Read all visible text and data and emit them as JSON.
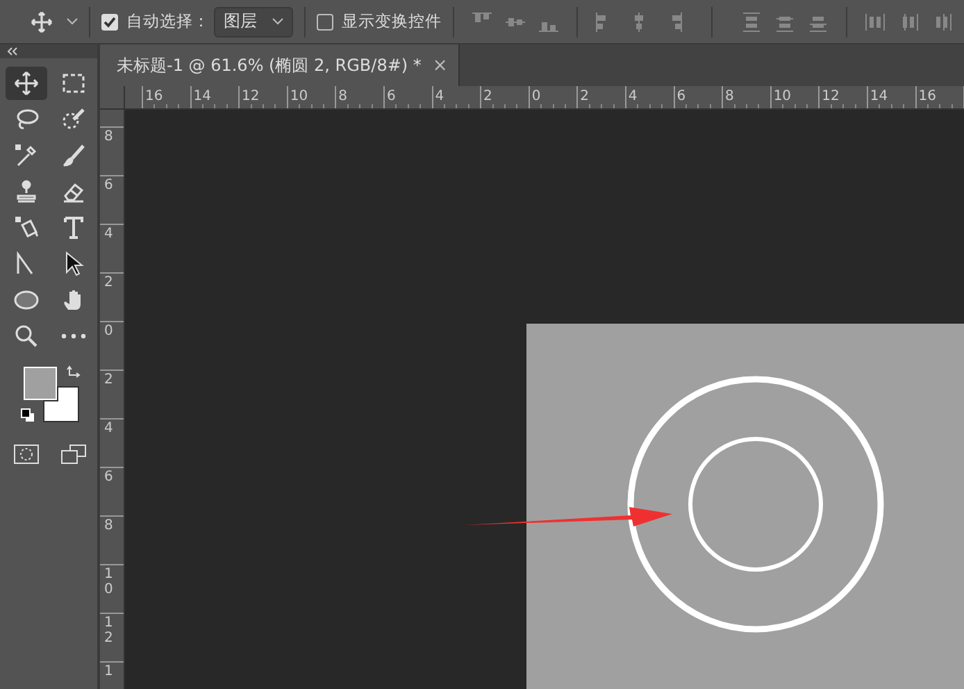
{
  "options_bar": {
    "auto_select": {
      "checked": true,
      "label": "自动选择："
    },
    "layer_dropdown": {
      "value": "图层"
    },
    "show_transform": {
      "checked": false,
      "label": "显示变换控件"
    }
  },
  "toolbox": {
    "tools": [
      {
        "kind": "move",
        "selected": true
      },
      {
        "kind": "marquee",
        "selected": false
      },
      {
        "kind": "lasso",
        "selected": false
      },
      {
        "kind": "quick-select",
        "selected": false
      },
      {
        "kind": "eyedropper",
        "selected": false
      },
      {
        "kind": "brush",
        "selected": false
      },
      {
        "kind": "stamp",
        "selected": false
      },
      {
        "kind": "eraser",
        "selected": false
      },
      {
        "kind": "bucket",
        "selected": false
      },
      {
        "kind": "type",
        "selected": false
      },
      {
        "kind": "path-select",
        "selected": false
      },
      {
        "kind": "direct-select",
        "selected": false
      },
      {
        "kind": "ellipse",
        "selected": false
      },
      {
        "kind": "hand",
        "selected": false
      },
      {
        "kind": "zoom",
        "selected": false
      },
      {
        "kind": "more",
        "selected": false
      }
    ]
  },
  "document_tab": {
    "title": "未标题-1 @ 61.6% (椭圆 2, RGB/8#) *",
    "close": "×",
    "selected": true
  },
  "horizontal_ruler": [
    "16",
    "14",
    "12",
    "10",
    "8",
    "6",
    "4",
    "2",
    "0",
    "2",
    "4",
    "6",
    "8",
    "10",
    "12",
    "14",
    "16"
  ],
  "vertical_ruler": [
    "8",
    "6",
    "4",
    "2",
    "0",
    "2",
    "4",
    "6",
    "8",
    "10",
    "12",
    "1"
  ]
}
